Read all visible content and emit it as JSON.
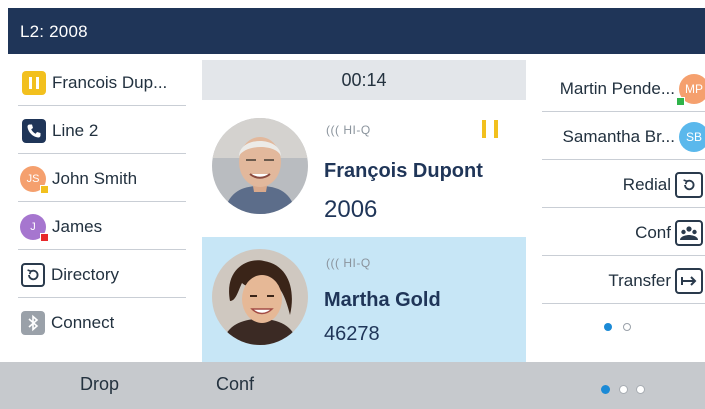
{
  "header": {
    "title": "L2: 2008"
  },
  "left_keys": [
    {
      "label": "Francois Dup...",
      "icon": "pause-icon"
    },
    {
      "label": "Line 2",
      "icon": "phone-icon"
    },
    {
      "label": "John Smith",
      "icon": "avatar",
      "initials": "JS",
      "presence_color": "#f2c01e"
    },
    {
      "label": "James",
      "icon": "avatar",
      "initials": "J",
      "presence_color": "#e8282b"
    },
    {
      "label": "Directory",
      "icon": "directory-icon"
    },
    {
      "label": "Connect",
      "icon": "bluetooth-icon"
    }
  ],
  "call_screen": {
    "timer": "00:14",
    "calls": [
      {
        "audio_badge": "((( HI-Q",
        "name": "François Dupont",
        "number": "2006",
        "state": "hold"
      },
      {
        "audio_badge": "((( HI-Q",
        "name": "Martha Gold",
        "number": "46278",
        "state": "active"
      }
    ]
  },
  "right_keys": [
    {
      "label": "Martin Pende...",
      "icon": "avatar",
      "initials": "MP",
      "presence_color": "#2fb34a"
    },
    {
      "label": "Samantha Br...",
      "icon": "avatar",
      "initials": "SB"
    },
    {
      "label": "Redial",
      "icon": "redial-icon"
    },
    {
      "label": "Conf",
      "icon": "conference-icon"
    },
    {
      "label": "Transfer",
      "icon": "transfer-icon"
    }
  ],
  "right_pager": {
    "pages": 2,
    "current": 1
  },
  "softkeys": [
    {
      "label": "Drop"
    },
    {
      "label": "Conf"
    }
  ],
  "softkey_pager": {
    "pages": 3,
    "current": 1
  },
  "colors": {
    "header": "#1f3558",
    "hold": "#f2c01e",
    "active_call_bg": "#c7e6f6",
    "pager_active": "#1b8ad6"
  }
}
